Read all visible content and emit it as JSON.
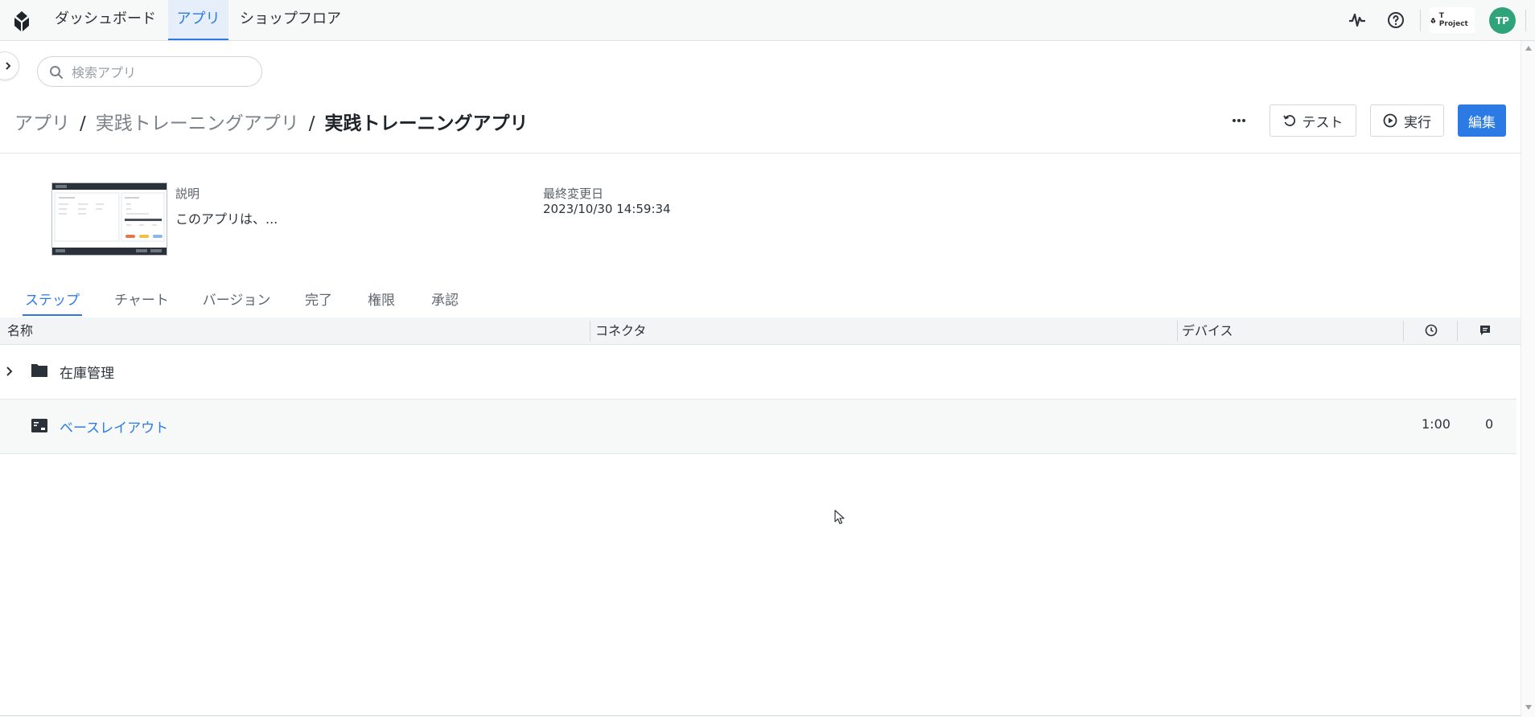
{
  "nav": {
    "items": [
      {
        "label": "ダッシュボード",
        "active": false
      },
      {
        "label": "アプリ",
        "active": true
      },
      {
        "label": "ショップフロア",
        "active": false
      }
    ],
    "project_label": "T Project",
    "avatar_initials": "TP"
  },
  "search": {
    "placeholder": "検索アプリ",
    "value": ""
  },
  "breadcrumb": {
    "root": "アプリ",
    "folder": "実践トレーニングアプリ",
    "current": "実践トレーニングアプリ",
    "separator": "/"
  },
  "actions": {
    "test_label": "テスト",
    "run_label": "実行",
    "edit_label": "編集"
  },
  "app_info": {
    "description_label": "説明",
    "description_value": "このアプリは、...",
    "modified_label": "最終変更日",
    "modified_value": "2023/10/30 14:59:34"
  },
  "tabs": [
    {
      "label": "ステップ",
      "active": true
    },
    {
      "label": "チャート",
      "active": false
    },
    {
      "label": "バージョン",
      "active": false
    },
    {
      "label": "完了",
      "active": false
    },
    {
      "label": "権限",
      "active": false
    },
    {
      "label": "承認",
      "active": false
    }
  ],
  "table": {
    "columns": {
      "name": "名称",
      "connector": "コネクタ",
      "device": "デバイス",
      "time_icon": "clock-icon",
      "comment_icon": "comment-icon"
    },
    "rows": [
      {
        "type": "folder",
        "name": "在庫管理",
        "time": "",
        "comments": ""
      },
      {
        "type": "step",
        "name": "ベースレイアウト",
        "time": "1:00",
        "comments": "0"
      }
    ]
  },
  "colors": {
    "accent": "#2c7be5",
    "avatar": "#2fa37a",
    "text": "#2d333a"
  }
}
